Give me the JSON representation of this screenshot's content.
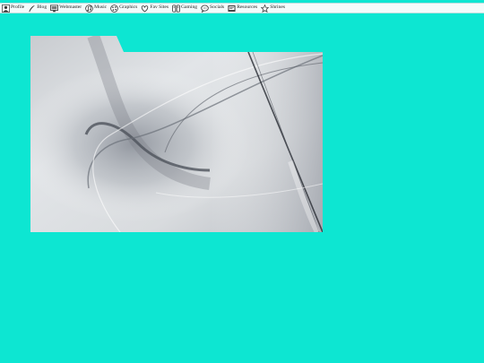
{
  "nav": {
    "items": [
      {
        "label": "Profile",
        "icon": "person-icon"
      },
      {
        "label": "Blog",
        "icon": "quill-icon"
      },
      {
        "label": "Webmaster",
        "icon": "monitor-icon"
      },
      {
        "label": "Music",
        "icon": "music-icon"
      },
      {
        "label": "Graphics",
        "icon": "palette-icon"
      },
      {
        "label": "Fav Sites",
        "icon": "heart-icon"
      },
      {
        "label": "Gaming",
        "icon": "gamepad-icon"
      },
      {
        "label": "Socials",
        "icon": "chat-icon"
      },
      {
        "label": "Resources",
        "icon": "folder-icon"
      },
      {
        "label": "Shrines",
        "icon": "star-icon"
      }
    ]
  },
  "colors": {
    "background": "#0de6d2",
    "bar": "#f4fbfb",
    "panel_light": "#e3e6e9",
    "panel_dark": "#5e6470"
  }
}
